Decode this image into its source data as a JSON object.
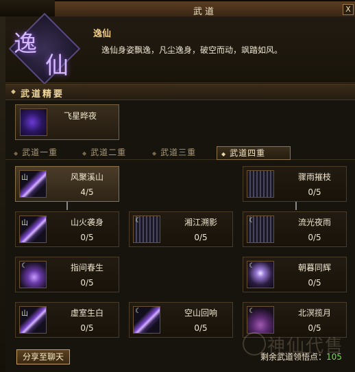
{
  "window": {
    "title": "武道",
    "help_glyph": "?",
    "close_glyph": "X"
  },
  "emblem": {
    "char1": "逸",
    "char2": "仙"
  },
  "skill": {
    "name": "逸仙",
    "description": "逸仙身姿飘逸，凡尘逸身，破空而动，飒踏如风。"
  },
  "section": {
    "title": "武道精要",
    "diamond": "◆"
  },
  "featured": {
    "name": "飞星晔夜"
  },
  "tabs": [
    {
      "label": "武道一重",
      "active": false
    },
    {
      "label": "武道二重",
      "active": false
    },
    {
      "label": "武道三重",
      "active": false
    },
    {
      "label": "武道四重",
      "active": true
    }
  ],
  "nodes": [
    {
      "name": "风聚溪山",
      "progress": "4/5",
      "icon": "sword-icon",
      "selected": true
    },
    {
      "name": "骤雨摧枝",
      "progress": "0/5",
      "icon": "rain-icon",
      "selected": false
    },
    {
      "name": "山火袭身",
      "progress": "0/5",
      "icon": "sword-icon",
      "selected": false
    },
    {
      "name": "湘江溯影",
      "progress": "0/5",
      "icon": "wave-icon",
      "selected": false
    },
    {
      "name": "流光夜雨",
      "progress": "0/5",
      "icon": "rain-icon",
      "selected": false
    },
    {
      "name": "指间春生",
      "progress": "0/5",
      "icon": "orb-icon",
      "selected": false
    },
    {
      "name": "朝暮同辉",
      "progress": "0/5",
      "icon": "figure-icon",
      "selected": false
    },
    {
      "name": "虚室生白",
      "progress": "0/5",
      "icon": "sword-icon",
      "selected": false
    },
    {
      "name": "空山回响",
      "progress": "0/5",
      "icon": "sword-icon",
      "selected": false
    },
    {
      "name": "北溟揽月",
      "progress": "0/5",
      "icon": "moon-icon",
      "selected": false
    }
  ],
  "footer": {
    "share_label": "分享至聊天",
    "points_label": "剩余武道领悟点：",
    "points_value": "105"
  },
  "watermark": {
    "text": "神仙代售",
    "sub": "SXDS.COM"
  },
  "colors": {
    "gold": "#f2ce84",
    "points_green": "#6ee04a",
    "emblem_purple": "#d6b8ff"
  }
}
